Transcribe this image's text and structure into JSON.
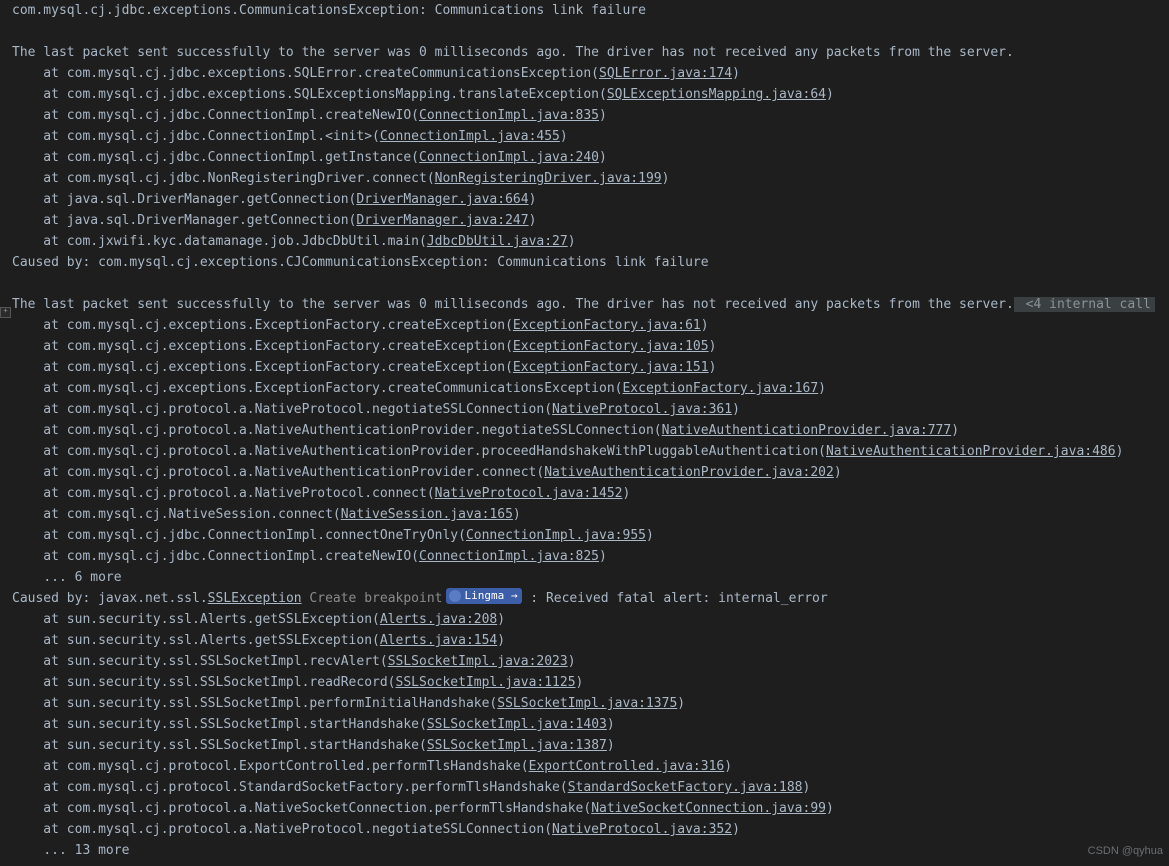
{
  "truncated_first_line": "com.mysql.cj.jdbc.exceptions.CommunicationsException: Communications link failure",
  "packet_msg": "The last packet sent successfully to the server was 0 milliseconds ago. The driver has not received any packets from the server.",
  "block1": [
    {
      "prefix": "at com.mysql.cj.jdbc.exceptions.SQLError.createCommunicationsException",
      "link": "SQLError.java:174"
    },
    {
      "prefix": "at com.mysql.cj.jdbc.exceptions.SQLExceptionsMapping.translateException",
      "link": "SQLExceptionsMapping.java:64"
    },
    {
      "prefix": "at com.mysql.cj.jdbc.ConnectionImpl.createNewIO",
      "link": "ConnectionImpl.java:835"
    },
    {
      "prefix": "at com.mysql.cj.jdbc.ConnectionImpl.<init>",
      "link": "ConnectionImpl.java:455"
    },
    {
      "prefix": "at com.mysql.cj.jdbc.ConnectionImpl.getInstance",
      "link": "ConnectionImpl.java:240"
    },
    {
      "prefix": "at com.mysql.cj.jdbc.NonRegisteringDriver.connect",
      "link": "NonRegisteringDriver.java:199"
    },
    {
      "prefix": "at java.sql.DriverManager.getConnection",
      "link": "DriverManager.java:664"
    },
    {
      "prefix": "at java.sql.DriverManager.getConnection",
      "link": "DriverManager.java:247"
    },
    {
      "prefix": "at com.jxwifi.kyc.datamanage.job.JdbcDbUtil.main",
      "link": "JdbcDbUtil.java:27"
    }
  ],
  "caused1": "Caused by: com.mysql.cj.exceptions.CJCommunicationsException: Communications link failure",
  "internal_calls": " <4 internal call",
  "block2": [
    {
      "prefix": "at com.mysql.cj.exceptions.ExceptionFactory.createException",
      "link": "ExceptionFactory.java:61"
    },
    {
      "prefix": "at com.mysql.cj.exceptions.ExceptionFactory.createException",
      "link": "ExceptionFactory.java:105"
    },
    {
      "prefix": "at com.mysql.cj.exceptions.ExceptionFactory.createException",
      "link": "ExceptionFactory.java:151"
    },
    {
      "prefix": "at com.mysql.cj.exceptions.ExceptionFactory.createCommunicationsException",
      "link": "ExceptionFactory.java:167"
    },
    {
      "prefix": "at com.mysql.cj.protocol.a.NativeProtocol.negotiateSSLConnection",
      "link": "NativeProtocol.java:361"
    },
    {
      "prefix": "at com.mysql.cj.protocol.a.NativeAuthenticationProvider.negotiateSSLConnection",
      "link": "NativeAuthenticationProvider.java:777"
    },
    {
      "prefix": "at com.mysql.cj.protocol.a.NativeAuthenticationProvider.proceedHandshakeWithPluggableAuthentication",
      "link": "NativeAuthenticationProvider.java:486"
    },
    {
      "prefix": "at com.mysql.cj.protocol.a.NativeAuthenticationProvider.connect",
      "link": "NativeAuthenticationProvider.java:202"
    },
    {
      "prefix": "at com.mysql.cj.protocol.a.NativeProtocol.connect",
      "link": "NativeProtocol.java:1452"
    },
    {
      "prefix": "at com.mysql.cj.NativeSession.connect",
      "link": "NativeSession.java:165"
    },
    {
      "prefix": "at com.mysql.cj.jdbc.ConnectionImpl.connectOneTryOnly",
      "link": "ConnectionImpl.java:955"
    },
    {
      "prefix": "at com.mysql.cj.jdbc.ConnectionImpl.createNewIO",
      "link": "ConnectionImpl.java:825"
    }
  ],
  "more1": "... 6 more",
  "caused2_prefix": "Caused by: javax.net.ssl.",
  "caused2_ex": "SSLException",
  "caused2_suffix": " : Received fatal alert: internal_error",
  "create_bp": "Create breakpoint",
  "lingma": "Lingma",
  "lingma_arrow": "→",
  "block3": [
    {
      "prefix": "at sun.security.ssl.Alerts.getSSLException",
      "link": "Alerts.java:208"
    },
    {
      "prefix": "at sun.security.ssl.Alerts.getSSLException",
      "link": "Alerts.java:154"
    },
    {
      "prefix": "at sun.security.ssl.SSLSocketImpl.recvAlert",
      "link": "SSLSocketImpl.java:2023"
    },
    {
      "prefix": "at sun.security.ssl.SSLSocketImpl.readRecord",
      "link": "SSLSocketImpl.java:1125"
    },
    {
      "prefix": "at sun.security.ssl.SSLSocketImpl.performInitialHandshake",
      "link": "SSLSocketImpl.java:1375"
    },
    {
      "prefix": "at sun.security.ssl.SSLSocketImpl.startHandshake",
      "link": "SSLSocketImpl.java:1403"
    },
    {
      "prefix": "at sun.security.ssl.SSLSocketImpl.startHandshake",
      "link": "SSLSocketImpl.java:1387"
    },
    {
      "prefix": "at com.mysql.cj.protocol.ExportControlled.performTlsHandshake",
      "link": "ExportControlled.java:316"
    },
    {
      "prefix": "at com.mysql.cj.protocol.StandardSocketFactory.performTlsHandshake",
      "link": "StandardSocketFactory.java:188"
    },
    {
      "prefix": "at com.mysql.cj.protocol.a.NativeSocketConnection.performTlsHandshake",
      "link": "NativeSocketConnection.java:99"
    },
    {
      "prefix": "at com.mysql.cj.protocol.a.NativeProtocol.negotiateSSLConnection",
      "link": "NativeProtocol.java:352"
    }
  ],
  "more2": "... 13 more",
  "stack_indent": "    ",
  "watermark": "CSDN @qyhua"
}
